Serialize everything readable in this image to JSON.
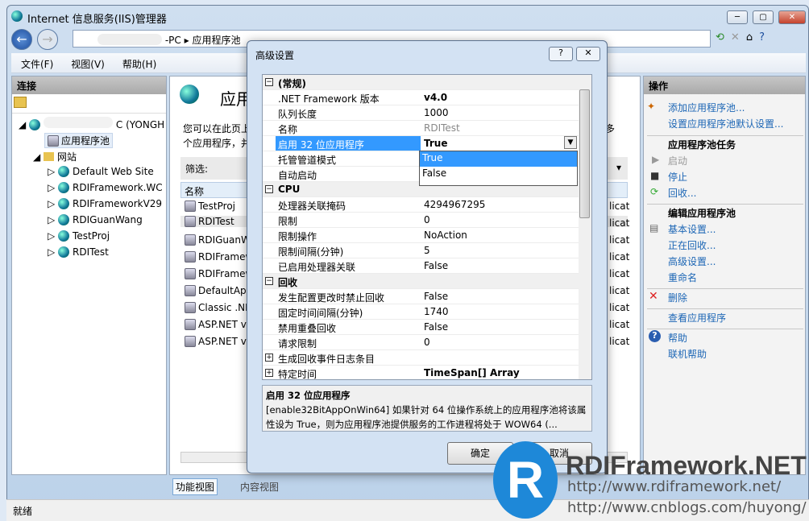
{
  "window": {
    "title": "Internet 信息服务(IIS)管理器",
    "controls": [
      "─",
      "▢",
      "✕"
    ]
  },
  "address": {
    "segments": [
      "-PC",
      "应用程序池"
    ]
  },
  "toolbar_right": [
    "⟲",
    "✕",
    "⌂",
    "?"
  ],
  "menu": [
    "文件(F)",
    "视图(V)",
    "帮助(H)"
  ],
  "connections": {
    "title": "连接",
    "server": "C (YONGH",
    "tree": [
      "应用程序池",
      "网站",
      "Default Web Site",
      "RDIFramework.WC",
      "RDIFrameworkV29",
      "RDIGuanWang",
      "TestProj",
      "RDITest"
    ]
  },
  "main": {
    "title": "应用",
    "desc1": "您可以在此页上",
    "desc2": "个应用程序，并",
    "desc_tail": "多",
    "filter_label": "筛选:",
    "col_name": "名称",
    "pools": [
      "TestProj",
      "RDITest",
      "RDIGuanW",
      "RDIFramew",
      "RDIFramew",
      "DefaultApp",
      "Classic .NE",
      "ASP.NET v",
      "ASP.NET v"
    ],
    "col_tail": "licat",
    "tabs": [
      "功能视图",
      "内容视图"
    ]
  },
  "actions": {
    "title": "操作",
    "items": [
      {
        "label": "添加应用程序池...",
        "type": "link"
      },
      {
        "label": "设置应用程序池默认设置...",
        "type": "link"
      },
      {
        "label": "应用程序池任务",
        "type": "head"
      },
      {
        "label": "启动",
        "type": "disabled"
      },
      {
        "label": "停止",
        "type": "link"
      },
      {
        "label": "回收...",
        "type": "link"
      },
      {
        "label": "编辑应用程序池",
        "type": "head"
      },
      {
        "label": "基本设置...",
        "type": "link"
      },
      {
        "label": "正在回收...",
        "type": "link"
      },
      {
        "label": "高级设置...",
        "type": "link"
      },
      {
        "label": "重命名",
        "type": "link"
      },
      {
        "label": "删除",
        "type": "link"
      },
      {
        "label": "查看应用程序",
        "type": "link"
      },
      {
        "label": "帮助",
        "type": "link"
      },
      {
        "label": "联机帮助",
        "type": "link"
      }
    ]
  },
  "dialog": {
    "title": "高级设置",
    "help": "?",
    "close": "✕",
    "rows": [
      {
        "cat": true,
        "exp": "⊟",
        "k": "(常规)"
      },
      {
        "k": ".NET Framework 版本",
        "v": "v4.0",
        "bold": true
      },
      {
        "k": "队列长度",
        "v": "1000"
      },
      {
        "k": "名称",
        "v": "RDITest",
        "gray": true
      },
      {
        "k": "启用 32 位应用程序",
        "v": "True",
        "bold": true,
        "sel": true
      },
      {
        "k": "托管管道模式",
        "v": ""
      },
      {
        "k": "自动启动",
        "v": ""
      },
      {
        "cat": true,
        "exp": "⊟",
        "k": "CPU"
      },
      {
        "k": "处理器关联掩码",
        "v": "4294967295"
      },
      {
        "k": "限制",
        "v": "0"
      },
      {
        "k": "限制操作",
        "v": "NoAction"
      },
      {
        "k": "限制间隔(分钟)",
        "v": "5"
      },
      {
        "k": "已启用处理器关联",
        "v": "False"
      },
      {
        "cat": true,
        "exp": "⊟",
        "k": "回收"
      },
      {
        "k": "发生配置更改时禁止回收",
        "v": "False"
      },
      {
        "k": "固定时间间隔(分钟)",
        "v": "1740"
      },
      {
        "k": "禁用重叠回收",
        "v": "False"
      },
      {
        "k": "请求限制",
        "v": "0"
      },
      {
        "exp": "⊞",
        "k": "生成回收事件日志条目",
        "v": ""
      },
      {
        "exp": "⊞",
        "k": "特定时间",
        "v": "TimeSpan[] Array",
        "bold": true
      }
    ],
    "dropdown": {
      "options": [
        "True",
        "False"
      ],
      "selected": "True"
    },
    "desc_title": "启用 32 位应用程序",
    "desc_text": "[enable32BitAppOnWin64] 如果针对 64 位操作系统上的应用程序池将该属性设为 True，则为应用程序池提供服务的工作进程将处于 WOW64 (...",
    "ok": "确定",
    "cancel": "取消"
  },
  "watermark": {
    "brand": "RDIFramework.NET",
    "url1": "http://www.rdiframework.net/",
    "url2": "http://www.cnblogs.com/huyong/"
  },
  "status": "就绪"
}
